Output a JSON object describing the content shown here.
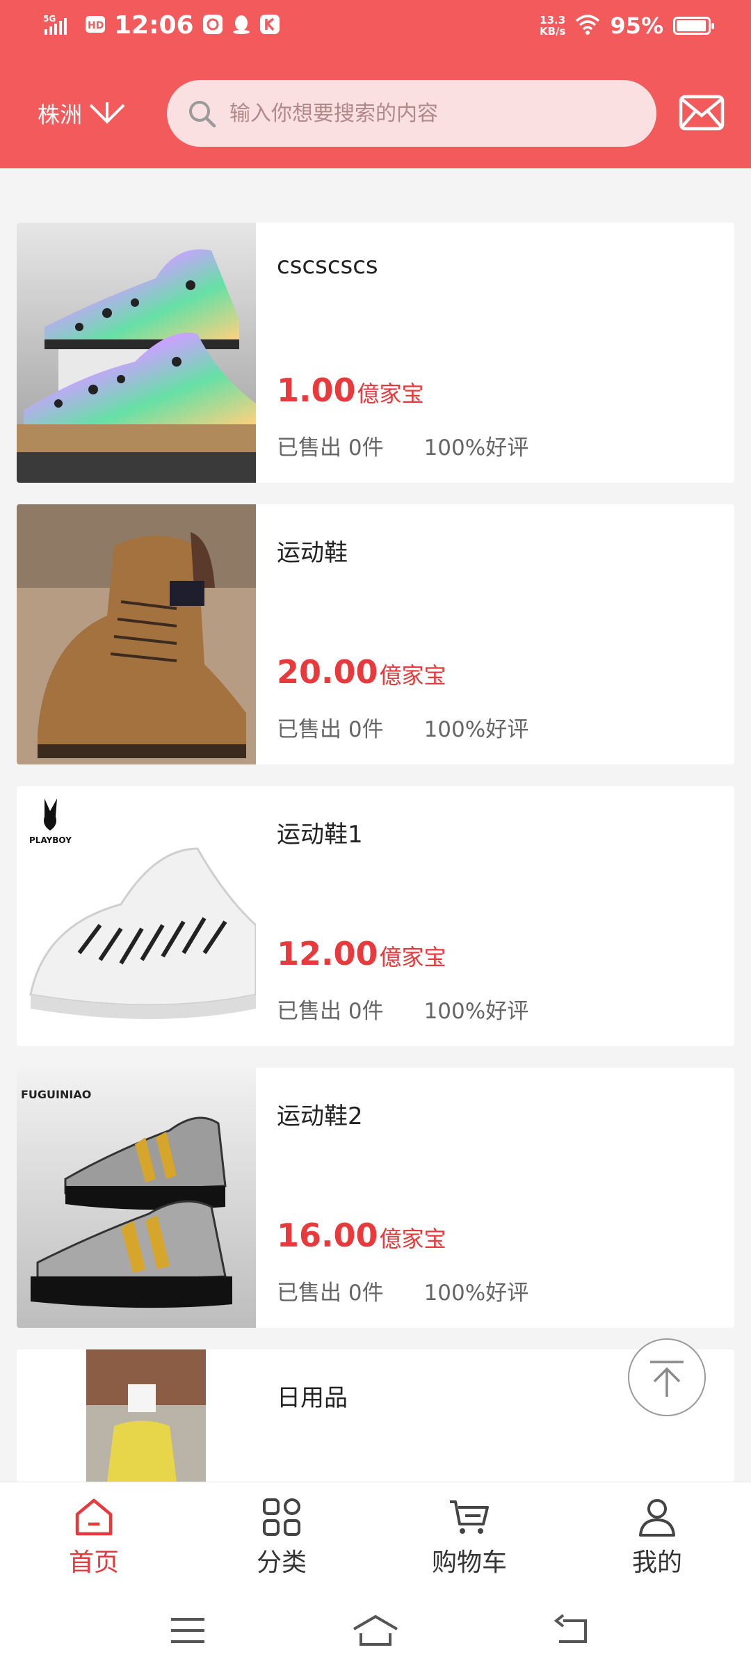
{
  "status_bar": {
    "network": "5G",
    "time": "12:06",
    "speed_top": "13.3",
    "speed_bottom": "KB/s",
    "battery": "95%"
  },
  "header": {
    "city": "株洲",
    "search_placeholder": "输入你想要搜索的内容"
  },
  "products": [
    {
      "title": "cscscscs",
      "price": "1.00",
      "unit": "億家宝",
      "sold": "已售出 0件",
      "rating": "100%好评"
    },
    {
      "title": "运动鞋",
      "price": "20.00",
      "unit": "億家宝",
      "sold": "已售出 0件",
      "rating": "100%好评"
    },
    {
      "title": "运动鞋1",
      "price": "12.00",
      "unit": "億家宝",
      "sold": "已售出 0件",
      "rating": "100%好评"
    },
    {
      "title": "运动鞋2",
      "price": "16.00",
      "unit": "億家宝",
      "sold": "已售出 0件",
      "rating": "100%好评"
    },
    {
      "title": "日用品"
    }
  ],
  "thumb_text": {
    "playboy": "PLAYBOY",
    "fuguiniao": "FUGUINIAO"
  },
  "tabs": [
    {
      "label": "首页",
      "icon": "home-icon",
      "active": true
    },
    {
      "label": "分类",
      "icon": "category-icon",
      "active": false
    },
    {
      "label": "购物车",
      "icon": "cart-icon",
      "active": false
    },
    {
      "label": "我的",
      "icon": "user-icon",
      "active": false
    }
  ],
  "colors": {
    "brand": "#f25a5c",
    "price": "#e83a3c"
  }
}
